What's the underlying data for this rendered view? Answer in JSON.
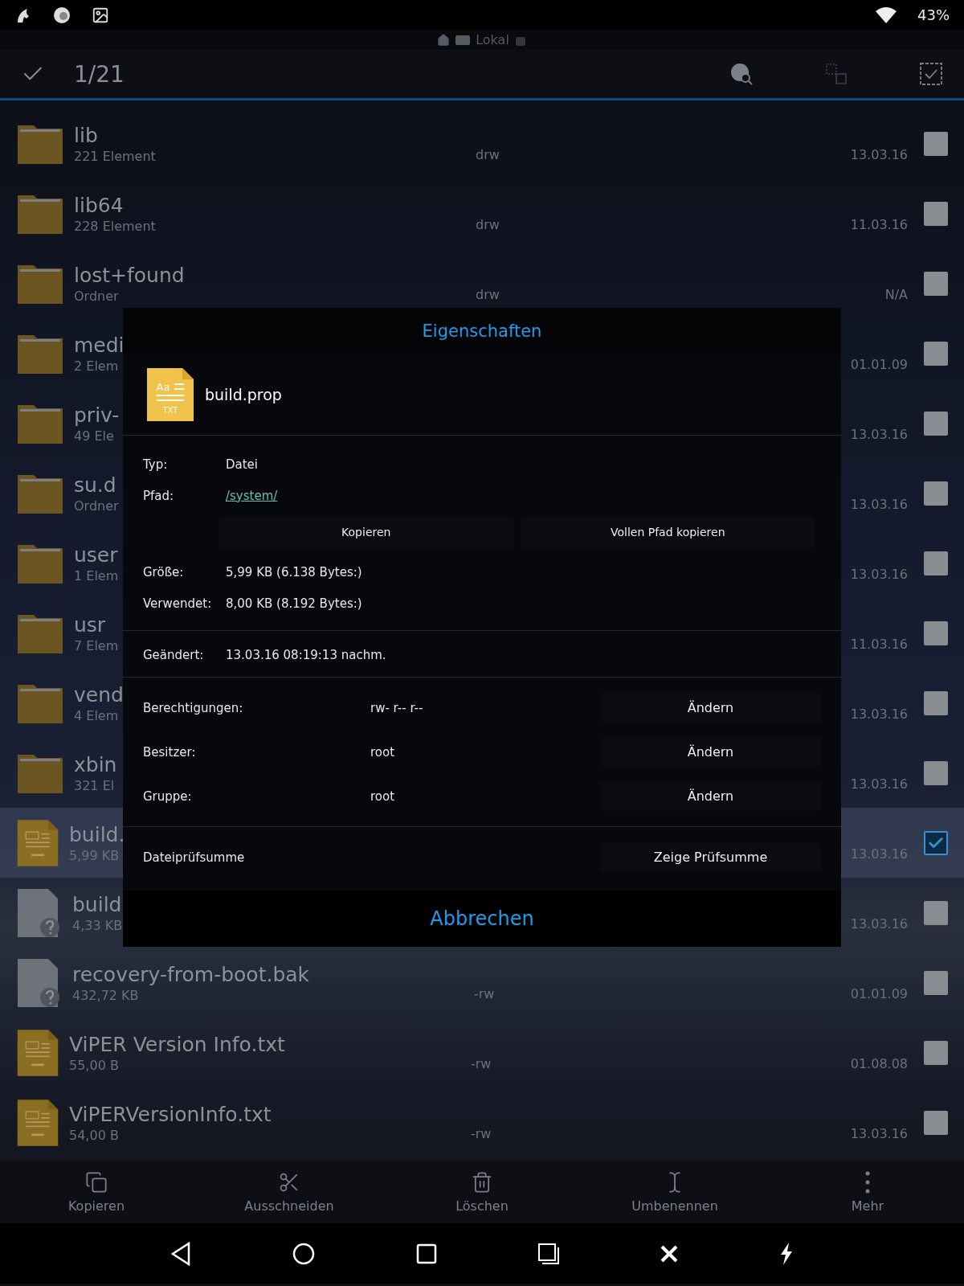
{
  "status_bar": {
    "battery": "43%"
  },
  "location": {
    "label": "Lokal"
  },
  "action_bar": {
    "count": "1/21"
  },
  "files": [
    {
      "name": "lib",
      "info": "221 Element",
      "perms": "drw",
      "date": "13.03.16",
      "kind": "folder",
      "checked": false,
      "selected": false
    },
    {
      "name": "lib64",
      "info": "228 Element",
      "perms": "drw",
      "date": "11.03.16",
      "kind": "folder",
      "checked": false,
      "selected": false
    },
    {
      "name": "lost+found",
      "info": "Ordner",
      "perms": "drw",
      "date": "N/A",
      "kind": "folder",
      "checked": false,
      "selected": false
    },
    {
      "name": "medi",
      "info": "2 Elem",
      "date": "01.01.09",
      "kind": "folder",
      "checked": false,
      "selected": false
    },
    {
      "name": "priv-",
      "info": "49 Ele",
      "date": "13.03.16",
      "kind": "folder",
      "checked": false,
      "selected": false
    },
    {
      "name": "su.d",
      "info": "Ordner",
      "date": "13.03.16",
      "kind": "folder",
      "checked": false,
      "selected": false
    },
    {
      "name": "user",
      "info": "1 Elem",
      "date": "13.03.16",
      "kind": "folder",
      "checked": false,
      "selected": false
    },
    {
      "name": "usr",
      "info": "7 Elem",
      "date": "11.03.16",
      "kind": "folder",
      "checked": false,
      "selected": false
    },
    {
      "name": "vend",
      "info": "4 Elem",
      "date": "13.03.16",
      "kind": "folder",
      "checked": false,
      "selected": false
    },
    {
      "name": "xbin",
      "info": "321 El",
      "date": "13.03.16",
      "kind": "folder",
      "checked": false,
      "selected": false
    },
    {
      "name": "build.",
      "info": "5,99 KB",
      "date": "13.03.16",
      "kind": "text",
      "checked": true,
      "selected": true
    },
    {
      "name": "build",
      "info": "4,33 KB",
      "date": "13.03.16",
      "kind": "unknown",
      "checked": false,
      "selected": false
    },
    {
      "name": "recovery-from-boot.bak",
      "info": "432,72 KB",
      "perms": "-rw",
      "date": "01.01.09",
      "kind": "unknown",
      "checked": false,
      "selected": false
    },
    {
      "name": "ViPER Version Info.txt",
      "info": "55,00 B",
      "perms": "-rw",
      "date": "01.08.08",
      "kind": "text",
      "checked": false,
      "selected": false
    },
    {
      "name": "ViPERVersionInfo.txt",
      "info": "54,00 B",
      "perms": "-rw",
      "date": "13.03.16",
      "kind": "text",
      "checked": false,
      "selected": false
    }
  ],
  "toolbar": [
    {
      "label": "Kopieren",
      "kind": "copy"
    },
    {
      "label": "Ausschneiden",
      "kind": "cut"
    },
    {
      "label": "Löschen",
      "kind": "delete"
    },
    {
      "label": "Umbenennen",
      "kind": "rename"
    },
    {
      "label": "Mehr",
      "kind": "more"
    }
  ],
  "dialog": {
    "title": "Eigenschaften",
    "file_name": "build.prop",
    "file_icon_label": "Aa",
    "file_icon_ext": "TXT",
    "type": {
      "label": "Typ:",
      "value": "Datei"
    },
    "path": {
      "label": "Pfad:",
      "value": "/system/"
    },
    "path_buttons": [
      "Kopieren",
      "Vollen Pfad kopieren"
    ],
    "sizes": [
      {
        "label": "Größe:",
        "value": "5,99 KB (6.138 Bytes:)"
      },
      {
        "label": "Verwendet:",
        "value": "8,00 KB (8.192 Bytes:)"
      }
    ],
    "modified": {
      "label": "Geändert:",
      "value": "13.03.16 08:19:13 nachm."
    },
    "ownership": [
      {
        "label": "Berechtigungen:",
        "value": "rw- r-- r--",
        "button": "Ändern"
      },
      {
        "label": "Besitzer:",
        "value": "root",
        "button": "Ändern"
      },
      {
        "label": "Gruppe:",
        "value": "root",
        "button": "Ändern"
      }
    ],
    "checksum": {
      "label": "Dateiprüfsumme",
      "button": "Zeige Prüfsumme"
    },
    "cancel": "Abbrechen"
  }
}
